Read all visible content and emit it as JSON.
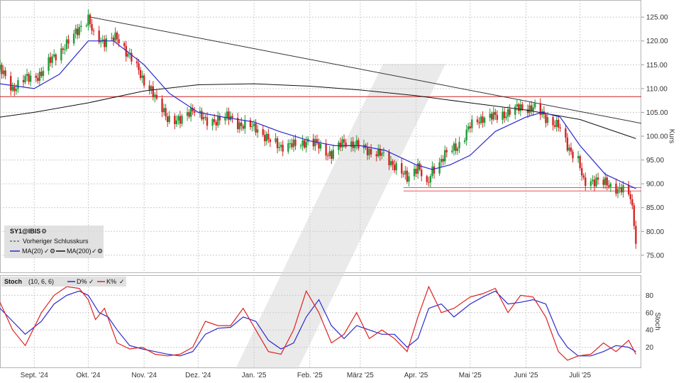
{
  "chart_data": [
    {
      "type": "candlestick",
      "panel": "price",
      "ylabel": "Kurs",
      "ylim": [
        72,
        128
      ],
      "yticks": [
        75,
        80,
        85,
        90,
        95,
        100,
        105,
        110,
        115,
        120,
        125
      ],
      "ytick_labels": [
        "75.00",
        "80.00",
        "85.00",
        "90.00",
        "95.00",
        "100.00",
        "105.00",
        "110.00",
        "115.00",
        "120.00",
        "125.00"
      ],
      "grid": true,
      "x_start": "2024-08-13",
      "x_end": "2025-08-04",
      "xticks": [
        "2024-09-01",
        "2024-10-01",
        "2024-11-01",
        "2024-12-01",
        "2025-01-01",
        "2025-02-01",
        "2025-03-01",
        "2025-04-01",
        "2025-05-01",
        "2025-06-01",
        "2025-07-01"
      ],
      "xtick_labels": [
        "Sept. '24",
        "Okt. '24",
        "Nov. '24",
        "Dez. '24",
        "Jan. '25",
        "Feb. '25",
        "März '25",
        "Apr. '25",
        "Mai '25",
        "Juni '25",
        "Juli '25"
      ],
      "legend": {
        "placement": "bottom-left",
        "title": "SY1@IBIS",
        "items": [
          "Vorheriger Schlusskurs",
          "MA(20)",
          "MA(200)"
        ]
      },
      "close_series": {
        "name": "SY1@IBIS",
        "points": [
          [
            "2024-08-13",
            114
          ],
          [
            "2024-08-20",
            110
          ],
          [
            "2024-08-27",
            112
          ],
          [
            "2024-09-05",
            113
          ],
          [
            "2024-09-12",
            117
          ],
          [
            "2024-09-19",
            119
          ],
          [
            "2024-09-26",
            123
          ],
          [
            "2024-10-01",
            124.5
          ],
          [
            "2024-10-04",
            121
          ],
          [
            "2024-10-10",
            120
          ],
          [
            "2024-10-17",
            120.5
          ],
          [
            "2024-10-24",
            117
          ],
          [
            "2024-10-31",
            112
          ],
          [
            "2024-11-05",
            110
          ],
          [
            "2024-11-08",
            107
          ],
          [
            "2024-11-14",
            104
          ],
          [
            "2024-11-21",
            103
          ],
          [
            "2024-11-28",
            106
          ],
          [
            "2024-12-05",
            103
          ],
          [
            "2024-12-12",
            103.5
          ],
          [
            "2024-12-19",
            104
          ],
          [
            "2024-12-26",
            102
          ],
          [
            "2025-01-02",
            102
          ],
          [
            "2025-01-09",
            99
          ],
          [
            "2025-01-16",
            98
          ],
          [
            "2025-01-23",
            98
          ],
          [
            "2025-01-30",
            99
          ],
          [
            "2025-02-06",
            98
          ],
          [
            "2025-02-13",
            96
          ],
          [
            "2025-02-20",
            99
          ],
          [
            "2025-02-27",
            98
          ],
          [
            "2025-03-06",
            97
          ],
          [
            "2025-03-13",
            96
          ],
          [
            "2025-03-20",
            94
          ],
          [
            "2025-03-27",
            91
          ],
          [
            "2025-04-02",
            94
          ],
          [
            "2025-04-07",
            89
          ],
          [
            "2025-04-10",
            93
          ],
          [
            "2025-04-17",
            96
          ],
          [
            "2025-04-24",
            98
          ],
          [
            "2025-05-01",
            102
          ],
          [
            "2025-05-08",
            104
          ],
          [
            "2025-05-15",
            104
          ],
          [
            "2025-05-22",
            105
          ],
          [
            "2025-05-29",
            106
          ],
          [
            "2025-06-05",
            106
          ],
          [
            "2025-06-12",
            104
          ],
          [
            "2025-06-19",
            102
          ],
          [
            "2025-06-24",
            98
          ],
          [
            "2025-06-30",
            95
          ],
          [
            "2025-07-03",
            90
          ],
          [
            "2025-07-10",
            91
          ],
          [
            "2025-07-17",
            89.5
          ],
          [
            "2025-07-24",
            89
          ],
          [
            "2025-07-29",
            87
          ],
          [
            "2025-07-31",
            82
          ],
          [
            "2025-08-01",
            78
          ]
        ]
      },
      "ma20": {
        "name": "MA(20)",
        "color": "#2b2bcc",
        "points": [
          [
            "2024-08-13",
            111
          ],
          [
            "2024-09-01",
            110
          ],
          [
            "2024-09-15",
            113
          ],
          [
            "2024-10-01",
            120
          ],
          [
            "2024-10-15",
            120
          ],
          [
            "2024-11-01",
            115
          ],
          [
            "2024-11-15",
            109
          ],
          [
            "2024-12-01",
            105
          ],
          [
            "2024-12-15",
            104
          ],
          [
            "2025-01-01",
            103
          ],
          [
            "2025-01-15",
            101
          ],
          [
            "2025-02-01",
            99
          ],
          [
            "2025-02-15",
            98
          ],
          [
            "2025-03-01",
            98
          ],
          [
            "2025-03-15",
            97
          ],
          [
            "2025-04-01",
            94
          ],
          [
            "2025-04-10",
            93
          ],
          [
            "2025-04-20",
            94
          ],
          [
            "2025-05-01",
            96
          ],
          [
            "2025-05-15",
            101
          ],
          [
            "2025-06-01",
            104
          ],
          [
            "2025-06-10",
            105
          ],
          [
            "2025-06-20",
            104
          ],
          [
            "2025-07-01",
            98
          ],
          [
            "2025-07-15",
            92
          ],
          [
            "2025-08-01",
            89
          ]
        ]
      },
      "ma200": {
        "name": "MA(200)",
        "color": "#111111",
        "points": [
          [
            "2024-08-13",
            104
          ],
          [
            "2024-09-01",
            105
          ],
          [
            "2024-10-01",
            107
          ],
          [
            "2024-11-01",
            109.5
          ],
          [
            "2024-12-01",
            110.8
          ],
          [
            "2025-01-01",
            111
          ],
          [
            "2025-02-01",
            110.5
          ],
          [
            "2025-03-01",
            109.7
          ],
          [
            "2025-04-01",
            108.5
          ],
          [
            "2025-05-01",
            107
          ],
          [
            "2025-06-01",
            105.5
          ],
          [
            "2025-07-01",
            103.5
          ],
          [
            "2025-08-01",
            99.5
          ]
        ]
      },
      "trendline": {
        "color": "#333333",
        "points": [
          [
            "2024-10-01",
            125.1
          ],
          [
            "2025-08-04",
            102.7
          ]
        ]
      },
      "resistance_line": {
        "value": 108.3,
        "color": "#cc2222"
      },
      "support_lines": [
        {
          "value": 89.2,
          "from": "2025-03-25",
          "color": "#ee5555"
        },
        {
          "value": 88.5,
          "from": "2025-03-25",
          "color": "#ee5555"
        }
      ]
    },
    {
      "type": "line",
      "panel": "stochastic",
      "title": "Stoch",
      "params": "(10, 6, 6)",
      "ylabel": "Stoch",
      "ylim": [
        0,
        100
      ],
      "yticks": [
        20,
        40,
        60,
        80
      ],
      "grid": true,
      "series": [
        {
          "name": "D%",
          "color": "#2b2bcc",
          "points": [
            [
              "2024-08-13",
              65
            ],
            [
              "2024-08-20",
              50
            ],
            [
              "2024-08-27",
              35
            ],
            [
              "2024-09-05",
              50
            ],
            [
              "2024-09-12",
              70
            ],
            [
              "2024-09-19",
              80
            ],
            [
              "2024-09-26",
              85
            ],
            [
              "2024-10-01",
              80
            ],
            [
              "2024-10-07",
              60
            ],
            [
              "2024-10-12",
              55
            ],
            [
              "2024-10-17",
              40
            ],
            [
              "2024-10-24",
              22
            ],
            [
              "2024-10-31",
              18
            ],
            [
              "2024-11-07",
              15
            ],
            [
              "2024-11-14",
              12
            ],
            [
              "2024-11-21",
              10
            ],
            [
              "2024-11-28",
              15
            ],
            [
              "2024-12-05",
              35
            ],
            [
              "2024-12-12",
              42
            ],
            [
              "2024-12-19",
              43
            ],
            [
              "2024-12-26",
              55
            ],
            [
              "2025-01-02",
              50
            ],
            [
              "2025-01-09",
              28
            ],
            [
              "2025-01-16",
              18
            ],
            [
              "2025-01-23",
              25
            ],
            [
              "2025-01-30",
              55
            ],
            [
              "2025-02-06",
              75
            ],
            [
              "2025-02-13",
              45
            ],
            [
              "2025-02-20",
              30
            ],
            [
              "2025-02-27",
              45
            ],
            [
              "2025-03-06",
              40
            ],
            [
              "2025-03-13",
              35
            ],
            [
              "2025-03-20",
              35
            ],
            [
              "2025-03-27",
              20
            ],
            [
              "2025-04-02",
              30
            ],
            [
              "2025-04-08",
              65
            ],
            [
              "2025-04-15",
              70
            ],
            [
              "2025-04-22",
              55
            ],
            [
              "2025-05-01",
              70
            ],
            [
              "2025-05-08",
              78
            ],
            [
              "2025-05-15",
              85
            ],
            [
              "2025-05-22",
              70
            ],
            [
              "2025-05-29",
              72
            ],
            [
              "2025-06-05",
              75
            ],
            [
              "2025-06-12",
              70
            ],
            [
              "2025-06-19",
              35
            ],
            [
              "2025-06-24",
              20
            ],
            [
              "2025-06-30",
              10
            ],
            [
              "2025-07-07",
              10
            ],
            [
              "2025-07-14",
              15
            ],
            [
              "2025-07-21",
              22
            ],
            [
              "2025-07-28",
              20
            ],
            [
              "2025-08-01",
              15
            ]
          ]
        },
        {
          "name": "K%",
          "color": "#dd2222",
          "points": [
            [
              "2024-08-13",
              72
            ],
            [
              "2024-08-20",
              40
            ],
            [
              "2024-08-27",
              22
            ],
            [
              "2024-09-05",
              60
            ],
            [
              "2024-09-12",
              80
            ],
            [
              "2024-09-19",
              90
            ],
            [
              "2024-09-26",
              88
            ],
            [
              "2024-10-01",
              75
            ],
            [
              "2024-10-05",
              52
            ],
            [
              "2024-10-10",
              65
            ],
            [
              "2024-10-17",
              25
            ],
            [
              "2024-10-24",
              18
            ],
            [
              "2024-10-31",
              20
            ],
            [
              "2024-11-07",
              12
            ],
            [
              "2024-11-14",
              10
            ],
            [
              "2024-11-21",
              12
            ],
            [
              "2024-11-28",
              20
            ],
            [
              "2024-12-05",
              50
            ],
            [
              "2024-12-12",
              45
            ],
            [
              "2024-12-19",
              45
            ],
            [
              "2024-12-26",
              65
            ],
            [
              "2025-01-02",
              40
            ],
            [
              "2025-01-09",
              15
            ],
            [
              "2025-01-16",
              12
            ],
            [
              "2025-01-23",
              40
            ],
            [
              "2025-01-30",
              85
            ],
            [
              "2025-02-06",
              60
            ],
            [
              "2025-02-13",
              25
            ],
            [
              "2025-02-20",
              35
            ],
            [
              "2025-02-27",
              60
            ],
            [
              "2025-03-06",
              30
            ],
            [
              "2025-03-13",
              40
            ],
            [
              "2025-03-20",
              30
            ],
            [
              "2025-03-27",
              15
            ],
            [
              "2025-04-02",
              55
            ],
            [
              "2025-04-08",
              90
            ],
            [
              "2025-04-15",
              60
            ],
            [
              "2025-04-22",
              65
            ],
            [
              "2025-05-01",
              78
            ],
            [
              "2025-05-08",
              82
            ],
            [
              "2025-05-15",
              88
            ],
            [
              "2025-05-22",
              60
            ],
            [
              "2025-05-29",
              80
            ],
            [
              "2025-06-05",
              78
            ],
            [
              "2025-06-12",
              55
            ],
            [
              "2025-06-19",
              15
            ],
            [
              "2025-06-24",
              5
            ],
            [
              "2025-06-30",
              10
            ],
            [
              "2025-07-07",
              12
            ],
            [
              "2025-07-14",
              25
            ],
            [
              "2025-07-21",
              15
            ],
            [
              "2025-07-28",
              28
            ],
            [
              "2025-08-01",
              12
            ]
          ]
        }
      ]
    }
  ]
}
